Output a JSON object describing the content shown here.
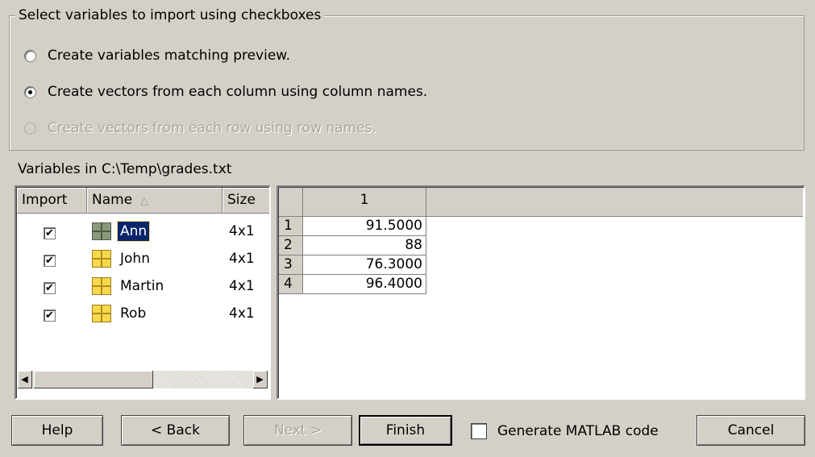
{
  "options": {
    "group_title": "Select variables to import using checkboxes",
    "radios": [
      {
        "label": "Create variables matching preview.",
        "checked": false,
        "enabled": true
      },
      {
        "label": "Create vectors from each column using column names.",
        "checked": true,
        "enabled": true
      },
      {
        "label": "Create vectors from each row using row names.",
        "checked": false,
        "enabled": false
      }
    ]
  },
  "variables": {
    "label": "Variables in C:\\Temp\\grades.txt",
    "columns": {
      "import": "Import",
      "name": "Name",
      "size": "Size"
    },
    "sort_indicator": "△",
    "rows": [
      {
        "checked": "✔",
        "name": "Ann",
        "size": "4x1",
        "selected": true
      },
      {
        "checked": "✔",
        "name": "John",
        "size": "4x1",
        "selected": false
      },
      {
        "checked": "✔",
        "name": "Martin",
        "size": "4x1",
        "selected": false
      },
      {
        "checked": "✔",
        "name": "Rob",
        "size": "4x1",
        "selected": false
      }
    ],
    "scroll_left": "◀",
    "scroll_right": "▶"
  },
  "preview": {
    "column_header": "1",
    "rows": [
      {
        "index": "1",
        "value": "91.5000"
      },
      {
        "index": "2",
        "value": "88"
      },
      {
        "index": "3",
        "value": "76.3000"
      },
      {
        "index": "4",
        "value": "96.4000"
      }
    ]
  },
  "buttons": {
    "help": "Help",
    "back": "< Back",
    "next": "Next >",
    "finish": "Finish",
    "generate_code": "Generate MATLAB code",
    "cancel": "Cancel"
  },
  "colors": {
    "dialog_bg": "#d4d0c8",
    "selection_bg": "#0a246a",
    "variable_icon": "#f7d94c"
  }
}
